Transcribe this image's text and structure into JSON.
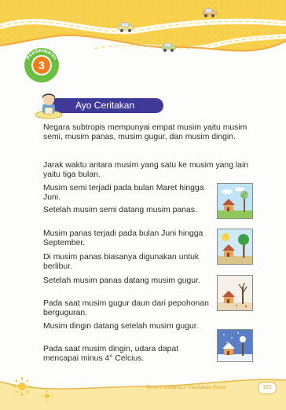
{
  "lesson": {
    "word": "Pembelajaran",
    "number": "3"
  },
  "section_title": "Ayo Ceritakan",
  "paragraphs": [
    "Negara subtropis mempunyai empat musim yaitu musim semi, musim panas, musim gugur, dan musim dingin.",
    "Jarak waktu antara musim yang satu ke musim yang lain yaitu tiga bulan.",
    "Musim semi terjadi pada bulan Maret hingga Juni.",
    "Setelah musim semi datang musim panas.",
    "Musim panas terjadi pada bulan Juni hingga September.",
    "Di musim panas biasanya digunakan untuk berlibur.",
    "Setelah musim panas datang musim gugur.",
    "Pada saat musim gugur daun dari pepohonan berguguran.",
    "Musim dingin datang setelah musim gugur.",
    "Pada saat musim dingin, udara dapat mencapai minus 4° Celcius."
  ],
  "footer": {
    "text": "Tema 3 Subtema 3: Perubahan Musim",
    "page_number": "151"
  },
  "colors": {
    "banner": "#3f3a97",
    "badge": "#f07d1a",
    "header_wave": "#f5c842",
    "footer_accent": "#e6b84a"
  }
}
